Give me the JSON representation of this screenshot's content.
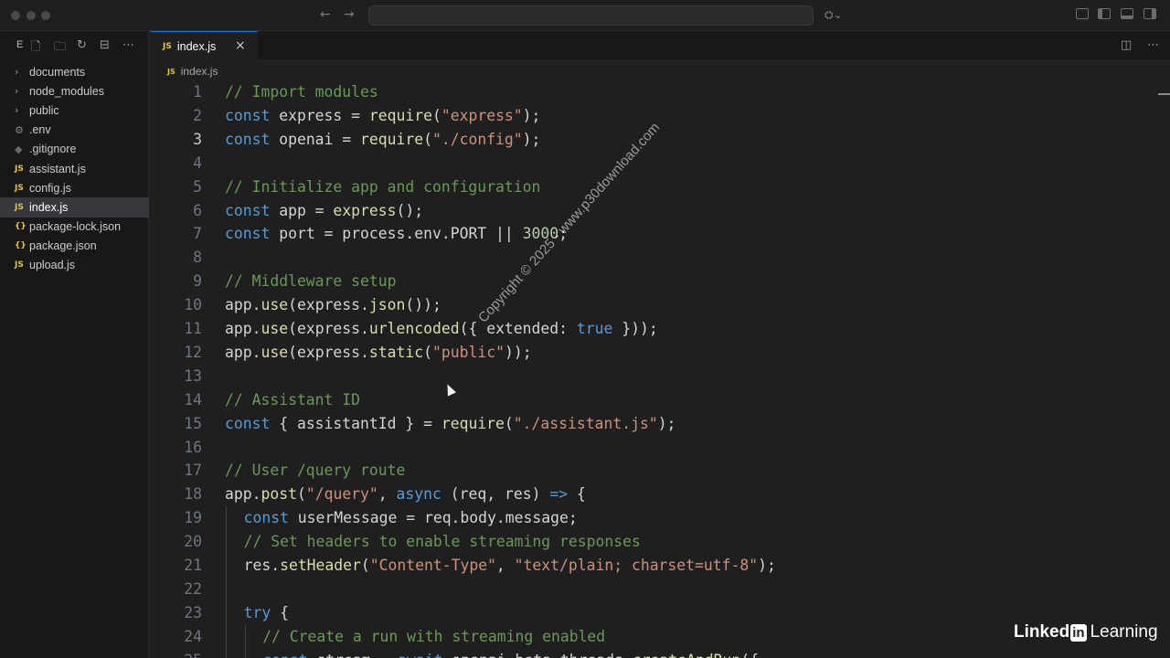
{
  "titlebar": {
    "back_icon": "arrow-left-icon",
    "forward_icon": "arrow-right-icon",
    "search_value": ""
  },
  "explorer": {
    "title": "E",
    "tools": [
      "new-file-icon",
      "new-folder-icon",
      "refresh-icon",
      "collapse-icon",
      "more-icon"
    ],
    "items": [
      {
        "label": "documents",
        "kind": "folder",
        "icon": "chevron-right-icon"
      },
      {
        "label": "node_modules",
        "kind": "folder",
        "icon": "chevron-right-icon"
      },
      {
        "label": "public",
        "kind": "folder",
        "icon": "chevron-right-icon"
      },
      {
        "label": ".env",
        "kind": "file",
        "icon": "gear-icon"
      },
      {
        "label": ".gitignore",
        "kind": "file",
        "icon": "diamond-icon"
      },
      {
        "label": "assistant.js",
        "kind": "file",
        "icon": "js-icon",
        "badge": "JS"
      },
      {
        "label": "config.js",
        "kind": "file",
        "icon": "js-icon",
        "badge": "JS"
      },
      {
        "label": "index.js",
        "kind": "file",
        "icon": "js-icon",
        "badge": "JS",
        "active": true
      },
      {
        "label": "package-lock.json",
        "kind": "file",
        "icon": "json-icon",
        "badge": "{}"
      },
      {
        "label": "package.json",
        "kind": "file",
        "icon": "json-icon",
        "badge": "{}"
      },
      {
        "label": "upload.js",
        "kind": "file",
        "icon": "js-icon",
        "badge": "JS"
      }
    ]
  },
  "tab": {
    "badge": "JS",
    "label": "index.js",
    "close": "×"
  },
  "breadcrumb": {
    "badge": "JS",
    "label": "index.js"
  },
  "editor": {
    "current_line": 3,
    "lines": [
      {
        "n": "1",
        "indent": 0,
        "tokens": [
          [
            "c-com",
            "// Import modules"
          ]
        ]
      },
      {
        "n": "2",
        "indent": 0,
        "tokens": [
          [
            "c-kw",
            "const"
          ],
          [
            "",
            " express = "
          ],
          [
            "c-fn",
            "require"
          ],
          [
            "",
            "("
          ],
          [
            "c-str",
            "\"express\""
          ],
          [
            "",
            ");"
          ]
        ]
      },
      {
        "n": "3",
        "indent": 0,
        "tokens": [
          [
            "c-kw",
            "const"
          ],
          [
            "",
            " openai = "
          ],
          [
            "c-fn",
            "require"
          ],
          [
            "",
            "("
          ],
          [
            "c-str",
            "\"./config\""
          ],
          [
            "",
            ");"
          ]
        ]
      },
      {
        "n": "4",
        "indent": 0,
        "tokens": []
      },
      {
        "n": "5",
        "indent": 0,
        "tokens": [
          [
            "c-com",
            "// Initialize app and configuration"
          ]
        ]
      },
      {
        "n": "6",
        "indent": 0,
        "tokens": [
          [
            "c-kw",
            "const"
          ],
          [
            "",
            " app = "
          ],
          [
            "c-fn",
            "express"
          ],
          [
            "",
            "();"
          ]
        ]
      },
      {
        "n": "7",
        "indent": 0,
        "tokens": [
          [
            "c-kw",
            "const"
          ],
          [
            "",
            " port = process.env.PORT || "
          ],
          [
            "c-num",
            "3000"
          ],
          [
            "",
            ";"
          ]
        ]
      },
      {
        "n": "8",
        "indent": 0,
        "tokens": []
      },
      {
        "n": "9",
        "indent": 0,
        "tokens": [
          [
            "c-com",
            "// Middleware setup"
          ]
        ]
      },
      {
        "n": "10",
        "indent": 0,
        "tokens": [
          [
            "",
            "app."
          ],
          [
            "c-fn",
            "use"
          ],
          [
            "",
            "(express."
          ],
          [
            "c-fn",
            "json"
          ],
          [
            "",
            "());"
          ]
        ]
      },
      {
        "n": "11",
        "indent": 0,
        "tokens": [
          [
            "",
            "app."
          ],
          [
            "c-fn",
            "use"
          ],
          [
            "",
            "(express."
          ],
          [
            "c-fn",
            "urlencoded"
          ],
          [
            "",
            "({ extended: "
          ],
          [
            "c-kw",
            "true"
          ],
          [
            "",
            " }));"
          ]
        ]
      },
      {
        "n": "12",
        "indent": 0,
        "tokens": [
          [
            "",
            "app."
          ],
          [
            "c-fn",
            "use"
          ],
          [
            "",
            "(express."
          ],
          [
            "c-fn",
            "static"
          ],
          [
            "",
            "("
          ],
          [
            "c-str",
            "\"public\""
          ],
          [
            "",
            "));"
          ]
        ]
      },
      {
        "n": "13",
        "indent": 0,
        "tokens": []
      },
      {
        "n": "14",
        "indent": 0,
        "tokens": [
          [
            "c-com",
            "// Assistant ID"
          ]
        ]
      },
      {
        "n": "15",
        "indent": 0,
        "tokens": [
          [
            "c-kw",
            "const"
          ],
          [
            "",
            " { assistantId } = "
          ],
          [
            "c-fn",
            "require"
          ],
          [
            "",
            "("
          ],
          [
            "c-str",
            "\"./assistant.js\""
          ],
          [
            "",
            ");"
          ]
        ]
      },
      {
        "n": "16",
        "indent": 0,
        "tokens": []
      },
      {
        "n": "17",
        "indent": 0,
        "tokens": [
          [
            "c-com",
            "// User /query route"
          ]
        ]
      },
      {
        "n": "18",
        "indent": 0,
        "tokens": [
          [
            "",
            "app."
          ],
          [
            "c-fn",
            "post"
          ],
          [
            "",
            "("
          ],
          [
            "c-str",
            "\"/query\""
          ],
          [
            "",
            ", "
          ],
          [
            "c-kw",
            "async"
          ],
          [
            "",
            " (req, res) "
          ],
          [
            "c-kw",
            "=>"
          ],
          [
            "",
            " {"
          ]
        ]
      },
      {
        "n": "19",
        "indent": 1,
        "tokens": [
          [
            "c-kw",
            "const"
          ],
          [
            "",
            " userMessage = req.body.message;"
          ]
        ]
      },
      {
        "n": "20",
        "indent": 1,
        "tokens": [
          [
            "c-com",
            "// Set headers to enable streaming responses"
          ]
        ]
      },
      {
        "n": "21",
        "indent": 1,
        "tokens": [
          [
            "",
            "res."
          ],
          [
            "c-fn",
            "setHeader"
          ],
          [
            "",
            "("
          ],
          [
            "c-str",
            "\"Content-Type\""
          ],
          [
            "",
            ", "
          ],
          [
            "c-str",
            "\"text/plain; charset=utf-8\""
          ],
          [
            "",
            ");"
          ]
        ]
      },
      {
        "n": "22",
        "indent": 1,
        "tokens": []
      },
      {
        "n": "23",
        "indent": 1,
        "tokens": [
          [
            "c-kw",
            "try"
          ],
          [
            "",
            " {"
          ]
        ]
      },
      {
        "n": "24",
        "indent": 2,
        "tokens": [
          [
            "c-com",
            "// Create a run with streaming enabled"
          ]
        ]
      },
      {
        "n": "25",
        "indent": 2,
        "tokens": [
          [
            "c-kw",
            "const"
          ],
          [
            "",
            " stream = "
          ],
          [
            "c-kw",
            "await"
          ],
          [
            "",
            " openai.beta.threads."
          ],
          [
            "c-fn",
            "createAndRun"
          ],
          [
            "",
            "({"
          ]
        ]
      }
    ]
  },
  "watermark": "Copyright © 2025 - www.p30download.com",
  "brand": {
    "part1": "Linked",
    "in": "in",
    "part2": "Learning"
  },
  "colors": {
    "accent": "#0078d4",
    "comment": "#6a9955",
    "keyword": "#569cd6",
    "string": "#ce9178",
    "function": "#dcdcaa",
    "number": "#b5cea8"
  }
}
